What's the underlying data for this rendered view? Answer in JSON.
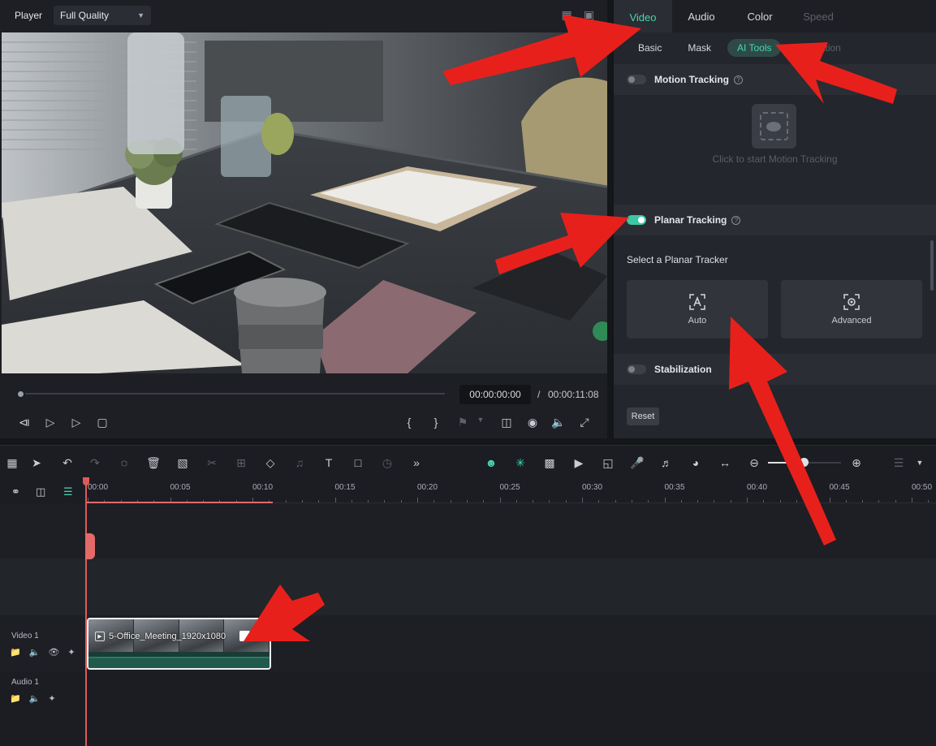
{
  "player": {
    "title": "Player",
    "quality": "Full Quality",
    "current_time": "00:00:00:00",
    "separator": "/",
    "total_time": "00:00:11:08"
  },
  "inspector": {
    "tabs": [
      "Video",
      "Audio",
      "Color",
      "Speed"
    ],
    "subtabs": [
      "Basic",
      "Mask",
      "AI Tools",
      "Animation"
    ],
    "motion_tracking": {
      "label": "Motion Tracking",
      "enabled": false,
      "caption": "Click to start Motion Tracking"
    },
    "planar_tracking": {
      "label": "Planar Tracking",
      "enabled": true,
      "select_label": "Select a Planar Tracker",
      "options": [
        "Auto",
        "Advanced"
      ]
    },
    "stabilization": {
      "label": "Stabilization",
      "enabled": false
    },
    "reset_label": "Reset"
  },
  "timeline": {
    "ruler_labels": [
      "00:00",
      "00:05",
      "00:10",
      "00:15",
      "00:20",
      "00:25",
      "00:30",
      "00:35",
      "00:40",
      "00:45",
      "00:50"
    ],
    "tracks": {
      "video": "Video 1",
      "audio": "Audio 1"
    },
    "clip": {
      "title": "5-Office_Meeting_1920x1080"
    }
  },
  "colors": {
    "accent": "#47d7b1",
    "annotation_arrow": "#e8201c",
    "playhead": "#e05a5a"
  }
}
